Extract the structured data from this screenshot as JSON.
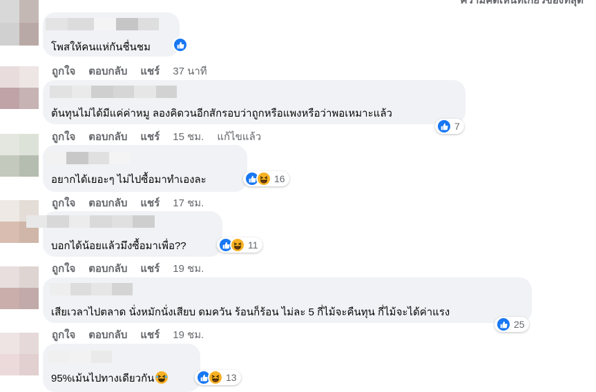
{
  "sort_label": "ความคิดเห็นที่เกี่ยวข้องที่สุด",
  "actions": {
    "like": "ถูกใจ",
    "reply": "ตอบกลับ",
    "share": "แชร์"
  },
  "colors": {
    "bubble": "#f0f2f5",
    "like_blue": "#1877f2",
    "haha_yellow": "#f7b125",
    "meta_gray": "#65676b"
  },
  "comments": [
    {
      "text": "โพสให้คนแห่กันชื่นชม",
      "time": "37 นาที",
      "reactions": [
        "like"
      ],
      "count": "",
      "edited": ""
    },
    {
      "text": "ต้นทุนไม่ได้มีแค่ค่าหมู ลองคิดวนอีกสักรอบว่าถูกหรือแพงหรือว่าพอเหมาะแล้ว",
      "time": "15 ชม.",
      "reactions": [
        "like"
      ],
      "count": "7",
      "edited": "แก้ไขแล้ว"
    },
    {
      "text": "อยากได้เยอะๆ ไม่ไปซื้อมาทำเองละ",
      "time": "17 ชม.",
      "reactions": [
        "like",
        "haha"
      ],
      "count": "16",
      "edited": ""
    },
    {
      "text": "บอกได้น้อยแล้วมึงซื้อมาเพื่อ??",
      "time": "19 ชม.",
      "reactions": [
        "like",
        "haha"
      ],
      "count": "11",
      "edited": ""
    },
    {
      "text": "เสียเวลาไปตลาด นั่งหมักนั่งเสียบ ดมควัน ร้อนก็ร้อน ไม่ละ 5 กี่ไม้จะคืนทุน กี่ไม้จะได้ค่าแรง",
      "time": "19 ชม.",
      "reactions": [
        "like"
      ],
      "count": "25",
      "edited": ""
    },
    {
      "text": "95%เม้นไปทางเดียวกัน",
      "time": "",
      "reactions": [
        "like",
        "haha"
      ],
      "count": "13",
      "edited": ""
    }
  ]
}
